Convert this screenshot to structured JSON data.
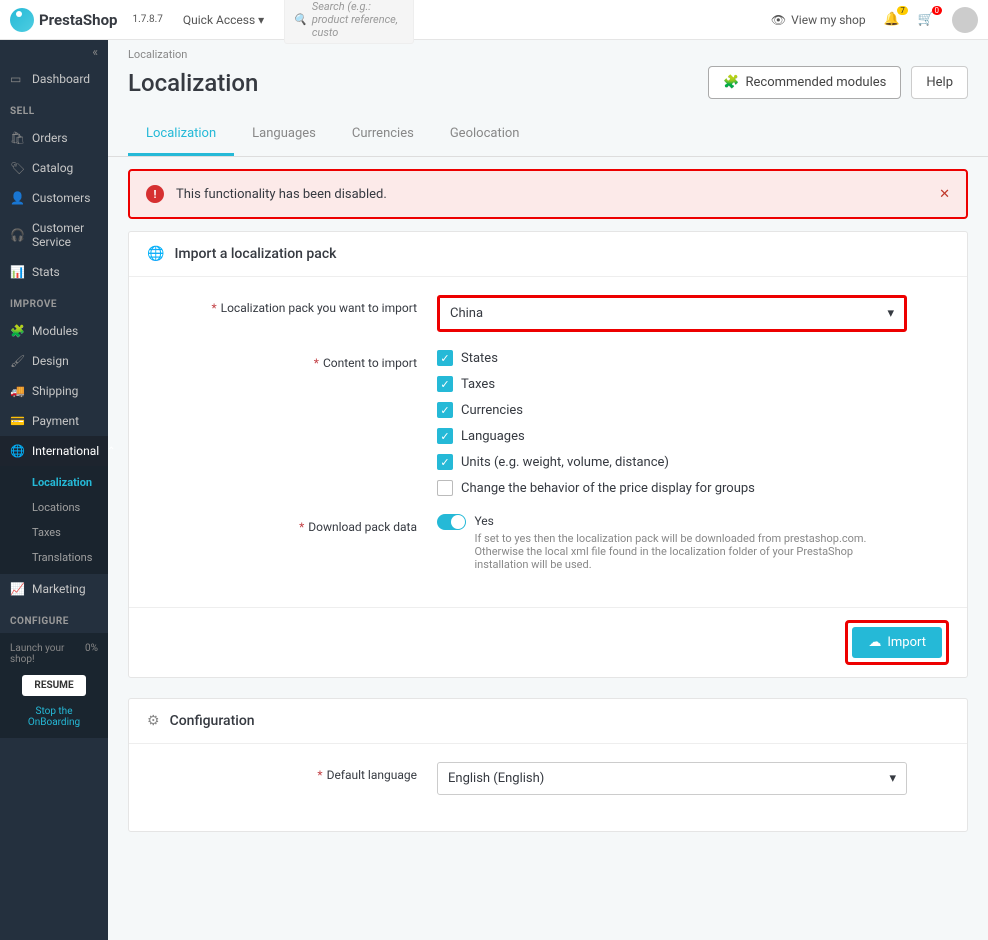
{
  "topbar": {
    "logo_text": "PrestaShop",
    "version": "1.7.8.7",
    "quick_access": "Quick Access",
    "search_placeholder": "Search (e.g.: product reference, custo",
    "view_shop": "View my shop",
    "bell_badge": "7",
    "cart_badge": "0"
  },
  "sidebar": {
    "dashboard": "Dashboard",
    "sections": {
      "sell_label": "SELL",
      "orders": "Orders",
      "catalog": "Catalog",
      "customers": "Customers",
      "customer_service": "Customer Service",
      "stats": "Stats",
      "improve_label": "IMPROVE",
      "modules": "Modules",
      "design": "Design",
      "shipping": "Shipping",
      "payment": "Payment",
      "international": "International",
      "marketing": "Marketing",
      "configure_label": "CONFIGURE"
    },
    "intl_sub": {
      "localization": "Localization",
      "locations": "Locations",
      "taxes": "Taxes",
      "translations": "Translations"
    },
    "launch_text": "Launch your shop!",
    "launch_pct": "0%",
    "resume": "RESUME",
    "stop": "Stop the OnBoarding"
  },
  "breadcrumb": "Localization",
  "page_title": "Localization",
  "header_buttons": {
    "recommended": "Recommended modules",
    "help": "Help"
  },
  "tabs": {
    "localization": "Localization",
    "languages": "Languages",
    "currencies": "Currencies",
    "geolocation": "Geolocation"
  },
  "alert": {
    "text": "This functionality has been disabled."
  },
  "import_card": {
    "title": "Import a localization pack",
    "pack_label": "Localization pack you want to import",
    "pack_value": "China",
    "content_label": "Content to import",
    "checks": {
      "states": "States",
      "taxes": "Taxes",
      "currencies": "Currencies",
      "languages": "Languages",
      "units": "Units (e.g. weight, volume, distance)",
      "price_behavior": "Change the behavior of the price display for groups"
    },
    "download_label": "Download pack data",
    "download_yes": "Yes",
    "download_desc": "If set to yes then the localization pack will be downloaded from prestashop.com. Otherwise the local xml file found in the localization folder of your PrestaShop installation will be used.",
    "import_button": "Import"
  },
  "config_card": {
    "title": "Configuration",
    "default_lang_label": "Default language",
    "default_lang_value": "English (English)"
  },
  "colors": {
    "accent": "#25b9d7",
    "alert_border": "#ed0000",
    "alert_bg": "#fceae9"
  }
}
